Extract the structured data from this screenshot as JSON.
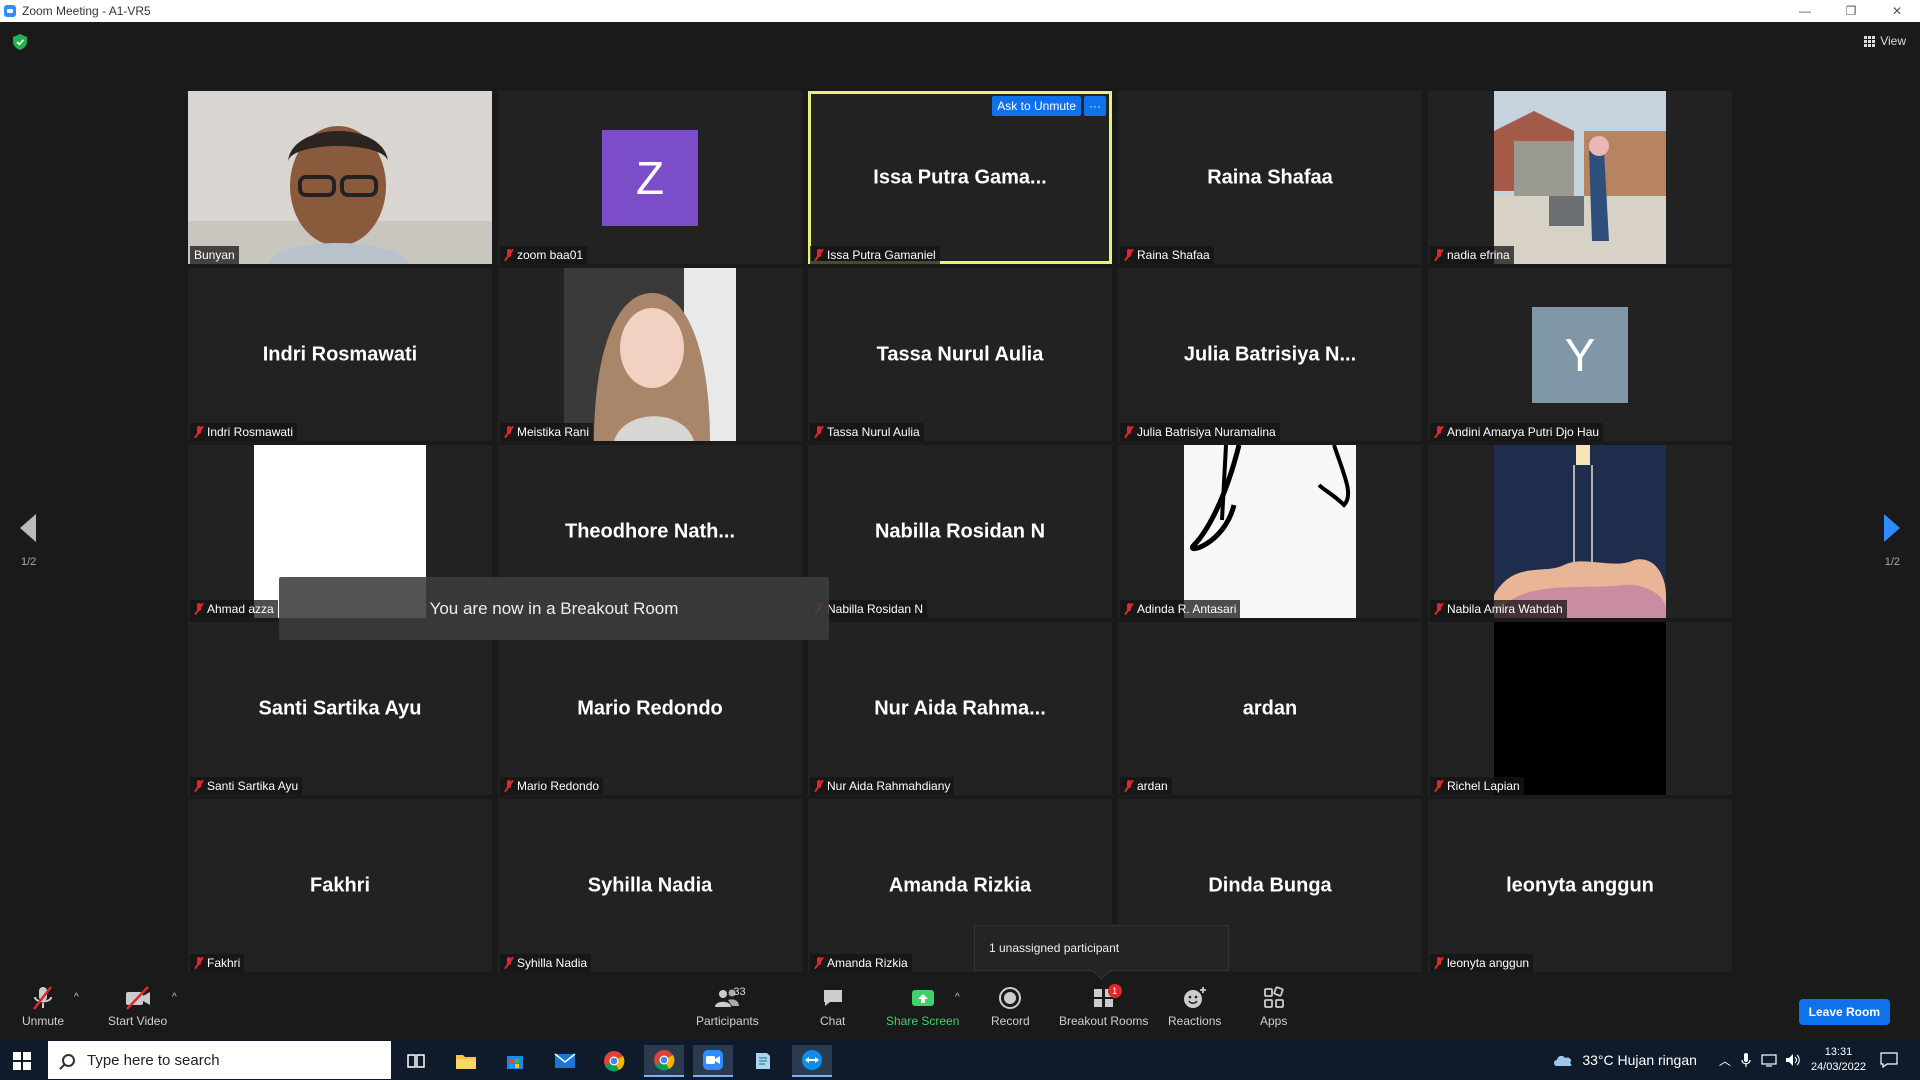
{
  "window": {
    "title": "Zoom Meeting - A1-VR5",
    "controls": [
      "—",
      "❐",
      "✕"
    ]
  },
  "header": {
    "view_label": "View"
  },
  "tiles": [
    {
      "name": "Bunyan",
      "display": "",
      "muted": false,
      "kind": "video-man"
    },
    {
      "name": "zoom baa01",
      "display": "",
      "muted": true,
      "kind": "letter",
      "letter": "Z",
      "color": "#7c4dc9"
    },
    {
      "name": "Issa Putra Gamaniel",
      "display": "Issa Putra Gama...",
      "muted": true,
      "kind": "name",
      "active": true
    },
    {
      "name": "Raina Shafaa",
      "display": "Raina Shafaa",
      "muted": true,
      "kind": "name"
    },
    {
      "name": "nadia efrina",
      "display": "",
      "muted": true,
      "kind": "photo-yard"
    },
    {
      "name": "Indri Rosmawati",
      "display": "Indri Rosmawati",
      "muted": true,
      "kind": "name"
    },
    {
      "name": "Meistika Rani",
      "display": "",
      "muted": true,
      "kind": "photo-hijab"
    },
    {
      "name": "Tassa Nurul Aulia",
      "display": "Tassa Nurul Aulia",
      "muted": true,
      "kind": "name"
    },
    {
      "name": "Julia Batrisiya Nuramalina",
      "display": "Julia Batrisiya N...",
      "muted": true,
      "kind": "name"
    },
    {
      "name": "Andini Amarya Putri Djo Hau",
      "display": "",
      "muted": true,
      "kind": "letter",
      "letter": "Y",
      "color": "#7f97a6"
    },
    {
      "name": "Ahmad azza",
      "display": "",
      "muted": true,
      "kind": "white"
    },
    {
      "name": "",
      "display": "Theodhore  Nath...",
      "muted": false,
      "kind": "name"
    },
    {
      "name": "Nabilla Rosidan N",
      "display": "Nabilla Rosidan N",
      "muted": true,
      "kind": "name"
    },
    {
      "name": "Adinda R. Antasari",
      "display": "",
      "muted": true,
      "kind": "photo-sketch"
    },
    {
      "name": "Nabila Amira Wahdah",
      "display": "",
      "muted": true,
      "kind": "photo-clouds"
    },
    {
      "name": "Santi Sartika Ayu",
      "display": "Santi Sartika Ayu",
      "muted": true,
      "kind": "name"
    },
    {
      "name": "Mario Redondo",
      "display": "Mario Redondo",
      "muted": true,
      "kind": "name"
    },
    {
      "name": "Nur Aida Rahmahdiany",
      "display": "Nur Aida Rahma...",
      "muted": true,
      "kind": "name"
    },
    {
      "name": "ardan",
      "display": "ardan",
      "muted": true,
      "kind": "name"
    },
    {
      "name": "Richel Lapian",
      "display": "",
      "muted": true,
      "kind": "black"
    },
    {
      "name": "Fakhri",
      "display": "Fakhri",
      "muted": true,
      "kind": "name"
    },
    {
      "name": "Syhilla Nadia",
      "display": "Syhilla Nadia",
      "muted": true,
      "kind": "name"
    },
    {
      "name": "Amanda Rizkia",
      "display": "Amanda Rizkia",
      "muted": true,
      "kind": "name"
    },
    {
      "name": "",
      "display": "Dinda Bunga",
      "muted": false,
      "kind": "name"
    },
    {
      "name": "leonyta anggun",
      "display": "leonyta anggun",
      "muted": true,
      "kind": "name"
    }
  ],
  "active_tile": {
    "ask_unmute_label": "Ask to Unmute",
    "more_label": "···"
  },
  "pagination": {
    "left": "1/2",
    "right": "1/2"
  },
  "toast": "You are now in a Breakout Room",
  "unassigned": "1 unassigned participant",
  "toolbar": {
    "unmute": "Unmute",
    "start_video": "Start Video",
    "participants": "Participants",
    "participants_count": "33",
    "chat": "Chat",
    "share_screen": "Share Screen",
    "record": "Record",
    "breakout_rooms": "Breakout Rooms",
    "breakout_badge": "1",
    "reactions": "Reactions",
    "apps": "Apps",
    "leave": "Leave Room"
  },
  "taskbar": {
    "search_placeholder": "Type here to search",
    "weather": "33°C  Hujan ringan",
    "time": "13:31",
    "date": "24/03/2022"
  },
  "colors": {
    "accent": "#0e72ed",
    "active_border": "#e8f07a",
    "share_green": "#3fd26a",
    "mute_red": "#e02828"
  }
}
